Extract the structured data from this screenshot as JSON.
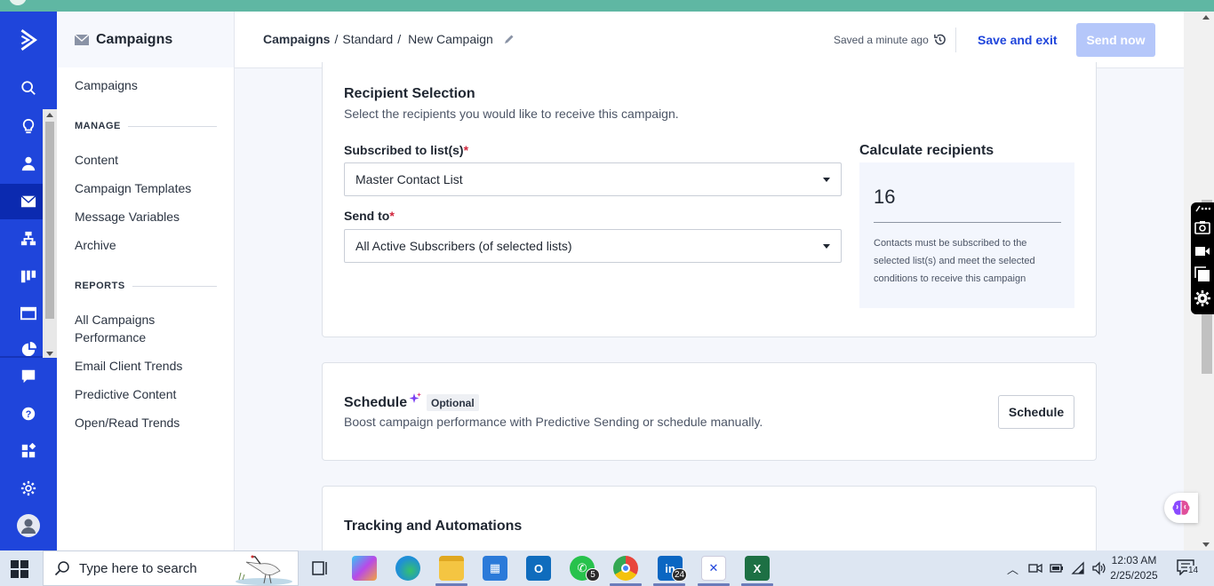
{
  "app": {
    "subnav_title": "Campaigns",
    "subnav_top_link": "Campaigns",
    "sections": [
      {
        "heading": "MANAGE",
        "items": [
          "Content",
          "Campaign Templates",
          "Message Variables",
          "Archive"
        ]
      },
      {
        "heading": "REPORTS",
        "items": [
          "All Campaigns Performance",
          "Email Client Trends",
          "Predictive Content",
          "Open/Read Trends"
        ]
      }
    ],
    "rail_icons": [
      "activecampaign-logo-icon",
      "search-icon",
      "lightbulb-icon",
      "contacts-icon",
      "campaigns-envelope-icon",
      "automations-icon",
      "deals-pipeline-icon",
      "website-icon",
      "reports-pie-icon",
      "conversations-icon",
      "help-icon",
      "apps-icon",
      "settings-gear-icon",
      "user-avatar-icon"
    ]
  },
  "header": {
    "breadcrumb_root": "Campaigns",
    "breadcrumb_mid": "Standard",
    "breadcrumb_current": "New Campaign",
    "saved_status": "Saved a minute ago",
    "save_exit_label": "Save and exit",
    "send_now_label": "Send now"
  },
  "recipient": {
    "title": "Recipient Selection",
    "subtitle": "Select the recipients you would like to receive this campaign.",
    "list_label": "Subscribed to list(s)",
    "list_value": "Master Contact List",
    "send_to_label": "Send to",
    "send_to_value": "All Active Subscribers (of selected lists)",
    "required_mark": "*",
    "calc_title": "Calculate recipients",
    "calc_count": "16",
    "calc_desc": "Contacts must be subscribed to the selected list(s) and meet the selected conditions to receive this campaign"
  },
  "schedule": {
    "title": "Schedule",
    "badge": "Optional",
    "subtitle": "Boost campaign performance with Predictive Sending or schedule manually.",
    "button_label": "Schedule"
  },
  "tracking": {
    "title": "Tracking and Automations"
  },
  "taskbar": {
    "search_placeholder": "Type here to search",
    "whatsapp_badge": "5",
    "linkedin_badge": "24",
    "time": "12:03 AM",
    "date": "2/25/2025",
    "notification_count": "14"
  },
  "colors": {
    "rail_blue": "#1f45db",
    "primary_link": "#1f45db",
    "send_disabled": "#b5c7fa",
    "required_red": "#d0263c",
    "top_strip": "#5fb7a3"
  }
}
